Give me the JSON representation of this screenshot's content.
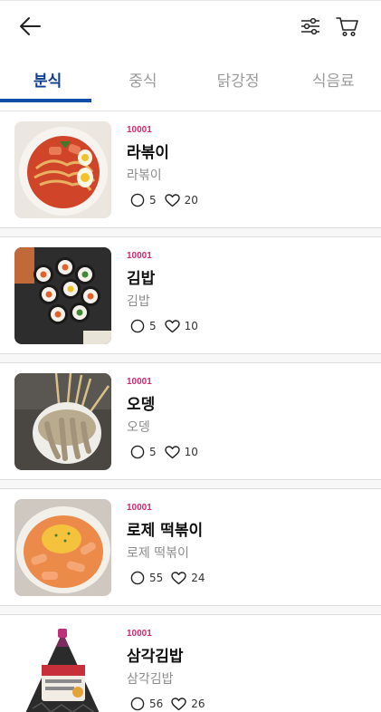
{
  "header": {
    "back_icon": "arrow-left-icon",
    "filter_icon": "sliders-icon",
    "cart_icon": "cart-icon"
  },
  "tabs": [
    {
      "label": "분식",
      "active": true
    },
    {
      "label": "중식",
      "active": false
    },
    {
      "label": "닭강정",
      "active": false
    },
    {
      "label": "식음료",
      "active": false
    }
  ],
  "colors": {
    "accent": "#0f4ea8",
    "code": "#d6266f"
  },
  "items": [
    {
      "code": "10001",
      "title": "라볶이",
      "subtitle": "라볶이",
      "comments": "5",
      "likes": "20"
    },
    {
      "code": "10001",
      "title": "김밥",
      "subtitle": "김밥",
      "comments": "5",
      "likes": "10"
    },
    {
      "code": "10001",
      "title": "오뎅",
      "subtitle": "오뎅",
      "comments": "5",
      "likes": "10"
    },
    {
      "code": "10001",
      "title": "로제 떡볶이",
      "subtitle": "로제 떡볶이",
      "comments": "55",
      "likes": "24"
    },
    {
      "code": "10001",
      "title": "삼각김밥",
      "subtitle": "삼각김밥",
      "comments": "56",
      "likes": "26"
    }
  ]
}
